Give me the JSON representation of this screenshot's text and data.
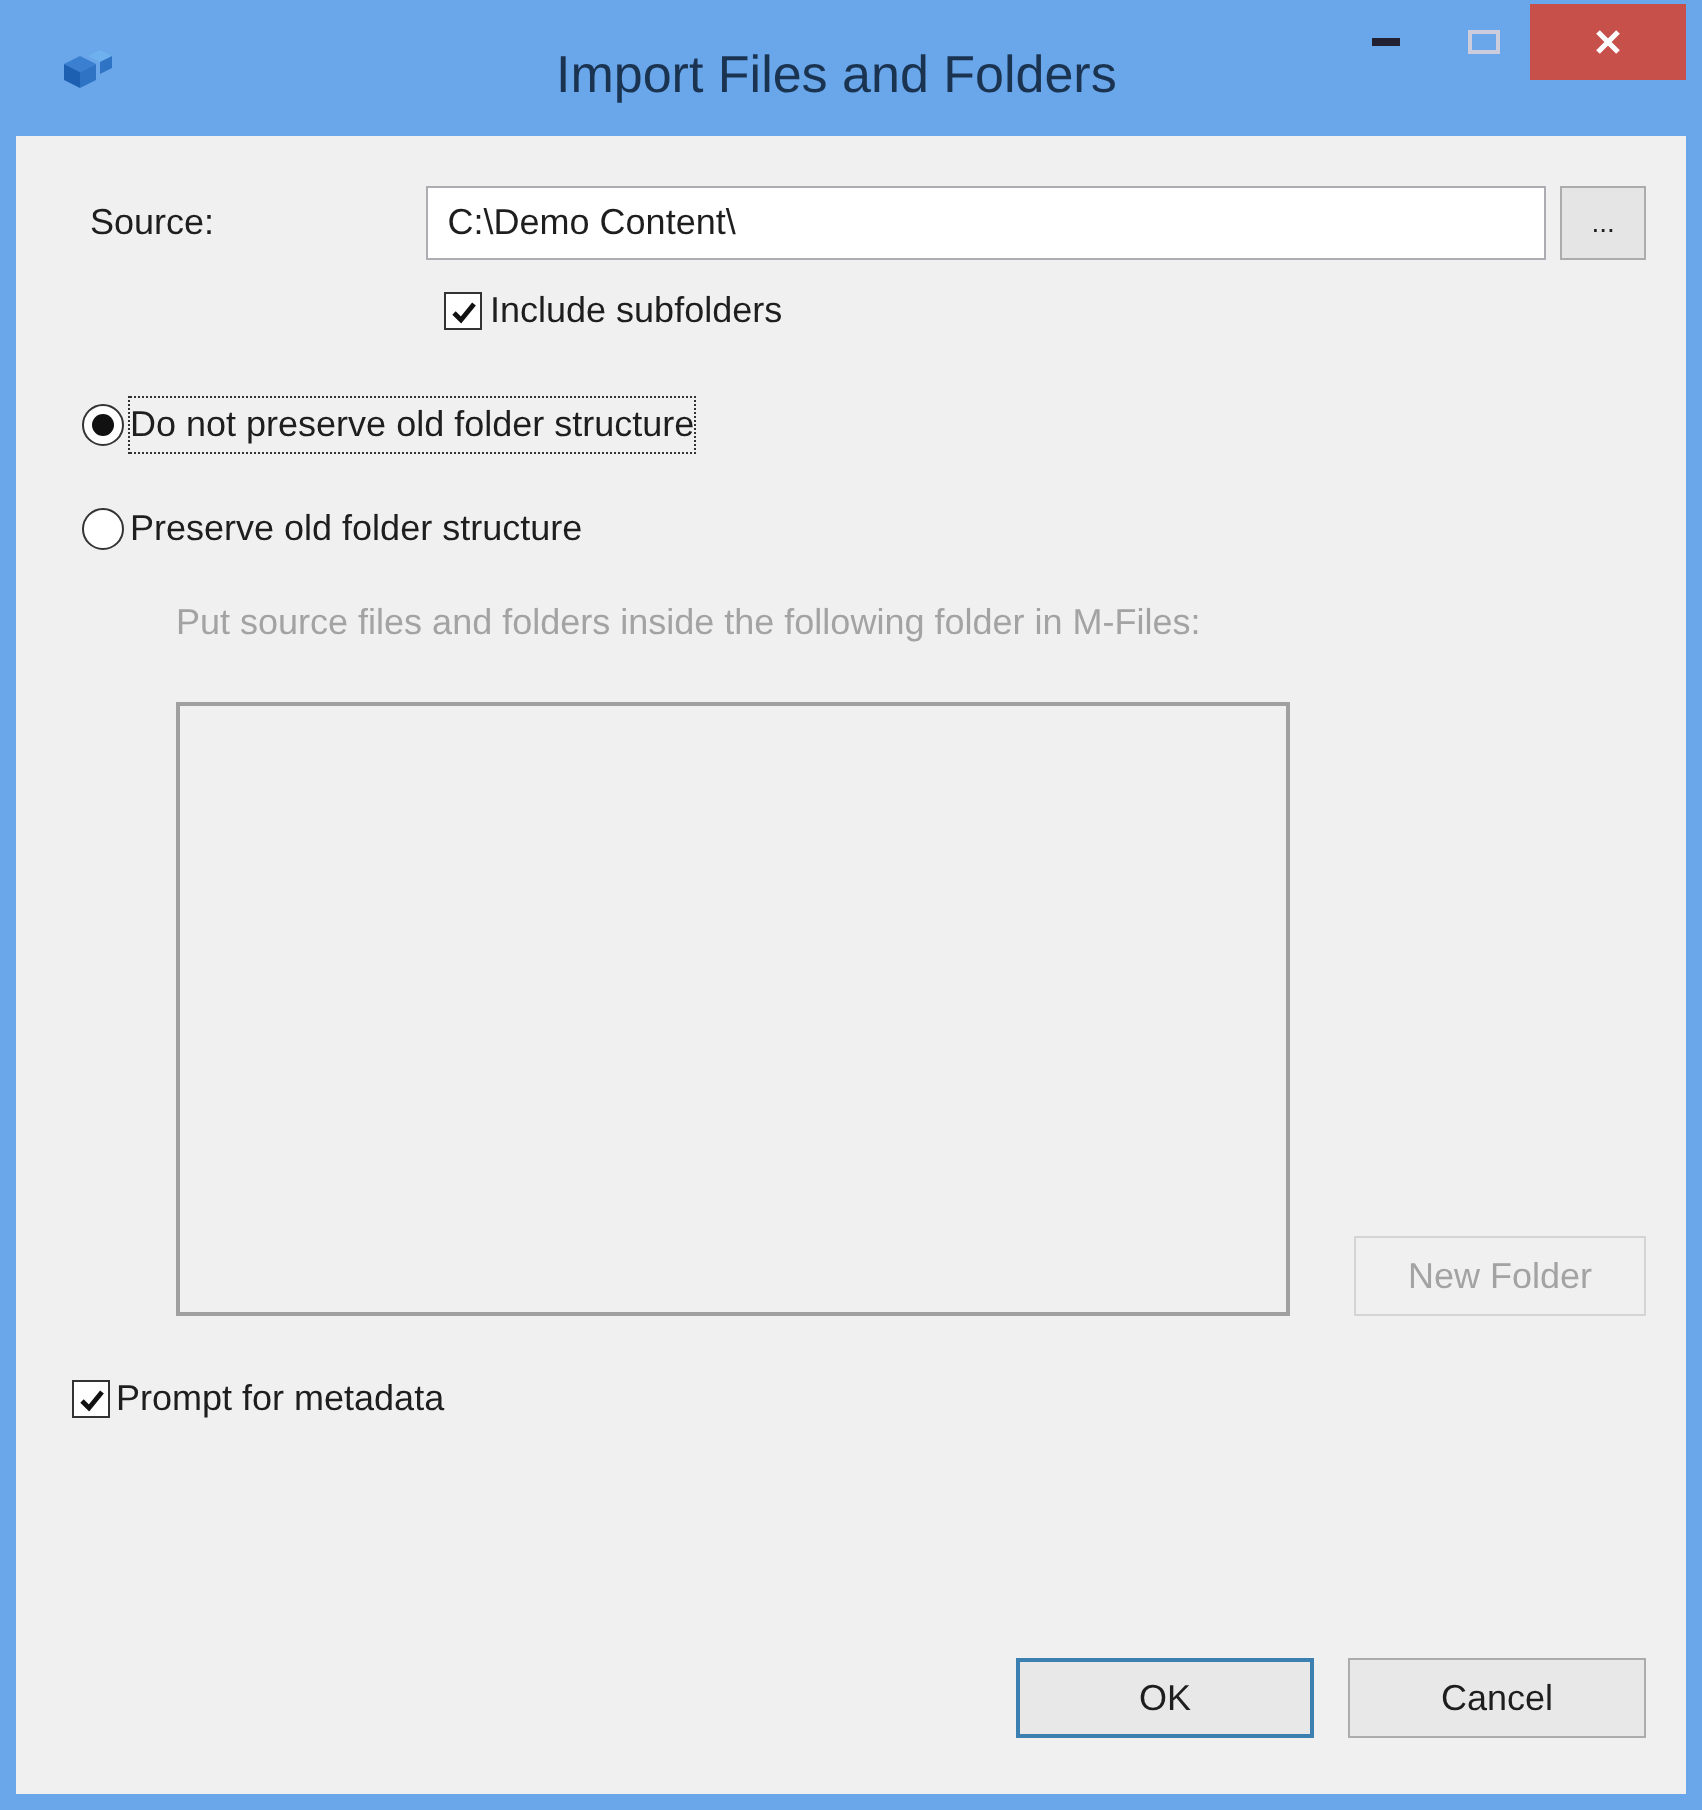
{
  "window": {
    "title": "Import Files and Folders"
  },
  "source": {
    "label": "Source:",
    "value": "C:\\Demo Content\\",
    "browse_label": "...",
    "include_subfolders": {
      "label": "Include subfolders",
      "checked": true
    }
  },
  "structure_options": [
    {
      "label": "Do not preserve old folder structure",
      "selected": true
    },
    {
      "label": "Preserve old folder structure",
      "selected": false
    }
  ],
  "target": {
    "hint": "Put source files and folders inside the following folder in M-Files:",
    "disabled": true,
    "new_folder": {
      "label": "New Folder",
      "disabled": true
    }
  },
  "prompt_for_metadata": {
    "label": "Prompt for metadata",
    "checked": true
  },
  "buttons": [
    {
      "label": "OK",
      "kind": "default"
    },
    {
      "label": "Cancel",
      "kind": "normal"
    }
  ]
}
